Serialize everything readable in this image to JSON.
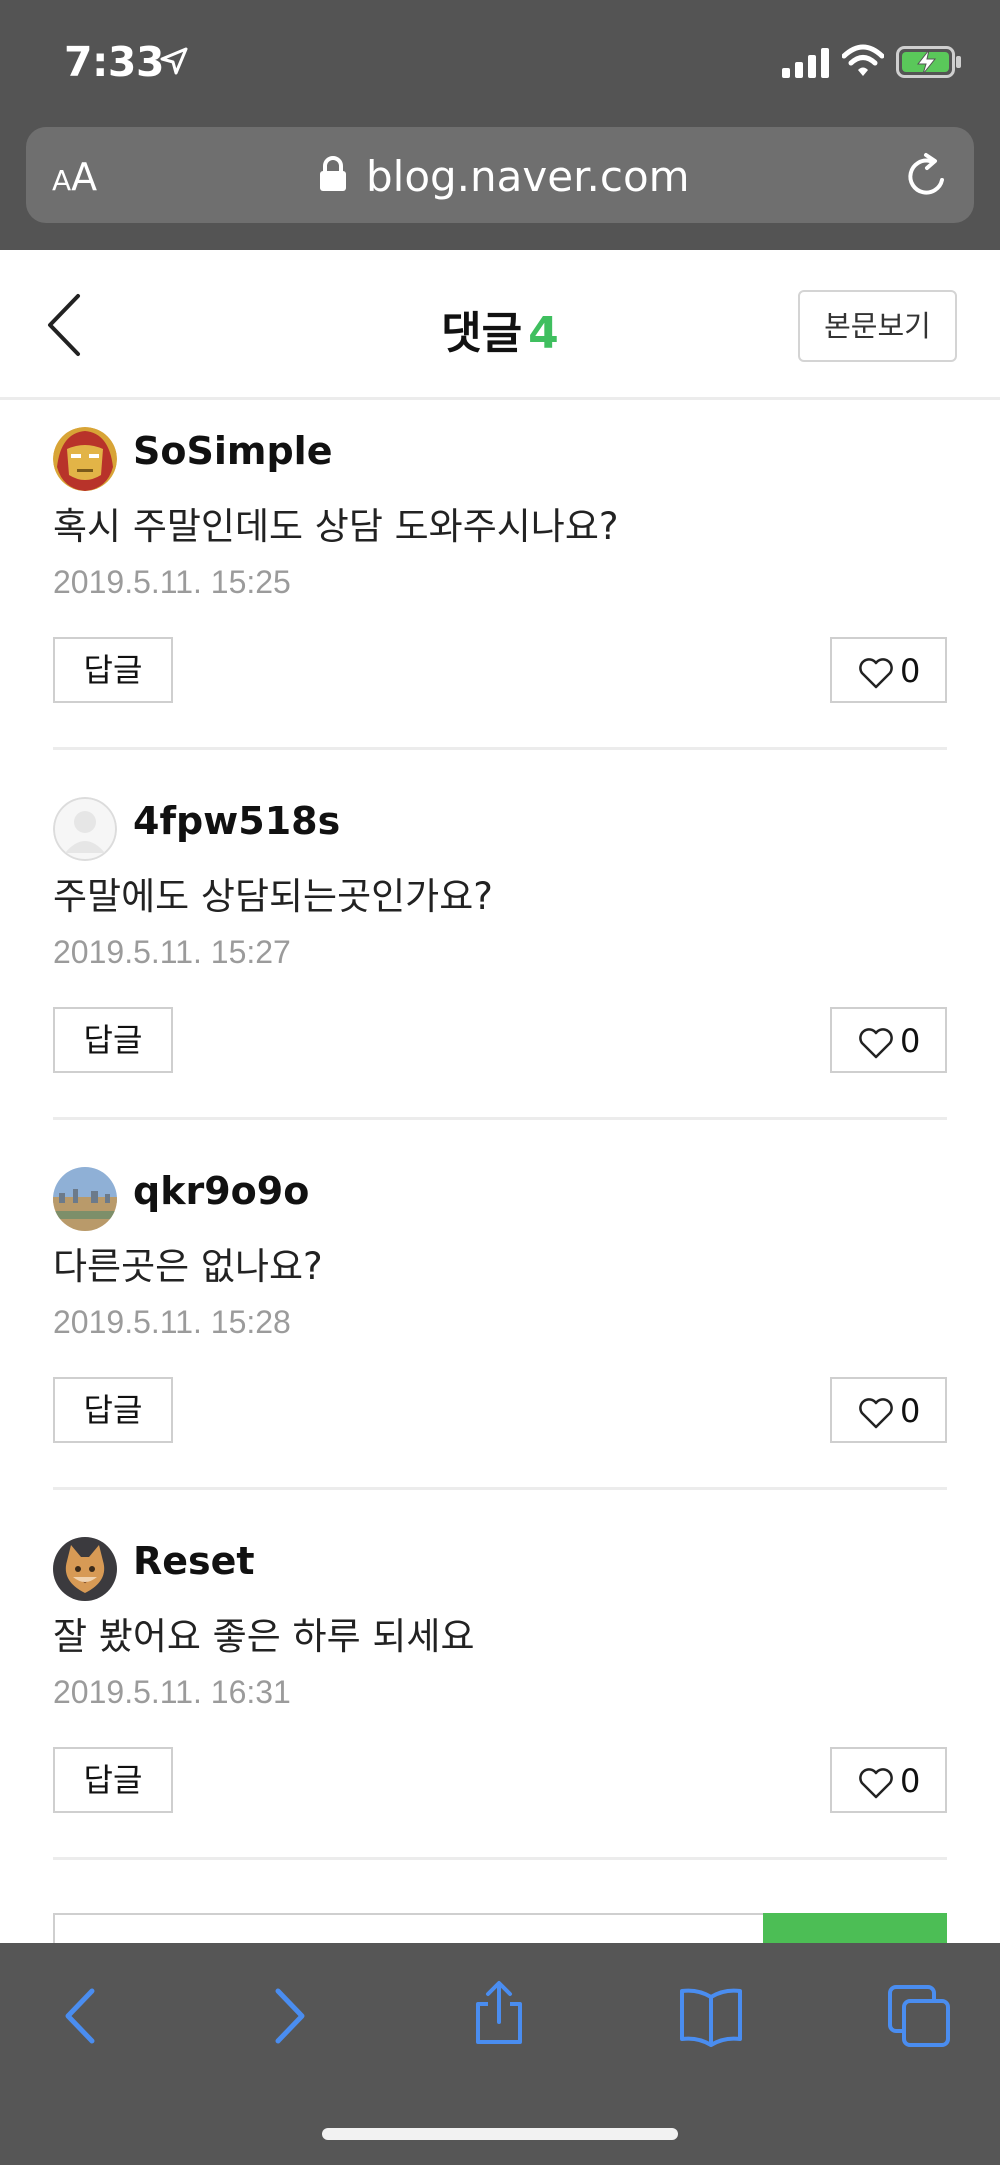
{
  "status_bar": {
    "time": "7:33"
  },
  "address_bar": {
    "aa_small": "A",
    "aa_big": "A",
    "url": "blog.naver.com"
  },
  "header": {
    "title": "댓글",
    "count": "4",
    "view_post_label": "본문보기"
  },
  "comments": [
    {
      "username": "SoSimple",
      "text": "혹시 주말인데도 상담 도와주시나요?",
      "date": "2019.5.11. 15:25",
      "reply_label": "답글",
      "likes": "0"
    },
    {
      "username": "4fpw518s",
      "text": "주말에도 상담되는곳인가요?",
      "date": "2019.5.11. 15:27",
      "reply_label": "답글",
      "likes": "0"
    },
    {
      "username": "qkr9o9o",
      "text": "다른곳은 없나요?",
      "date": "2019.5.11. 15:28",
      "reply_label": "답글",
      "likes": "0"
    },
    {
      "username": "Reset",
      "text": "잘 봤어요 좋은 하루 되세요",
      "date": "2019.5.11. 16:31",
      "reply_label": "답글",
      "likes": "0"
    }
  ],
  "colors": {
    "accent_green": "#3fbf5f",
    "chrome_gray": "#545454",
    "toolbar_blue": "#4a8df0"
  },
  "icons": {
    "status": [
      "location-arrow-icon",
      "signal-icon",
      "wifi-icon",
      "battery-charging-icon"
    ],
    "address": [
      "lock-icon",
      "reload-icon"
    ],
    "toolbar": [
      "back-arrow-icon",
      "forward-arrow-icon",
      "share-icon",
      "bookmarks-icon",
      "tabs-icon"
    ]
  }
}
